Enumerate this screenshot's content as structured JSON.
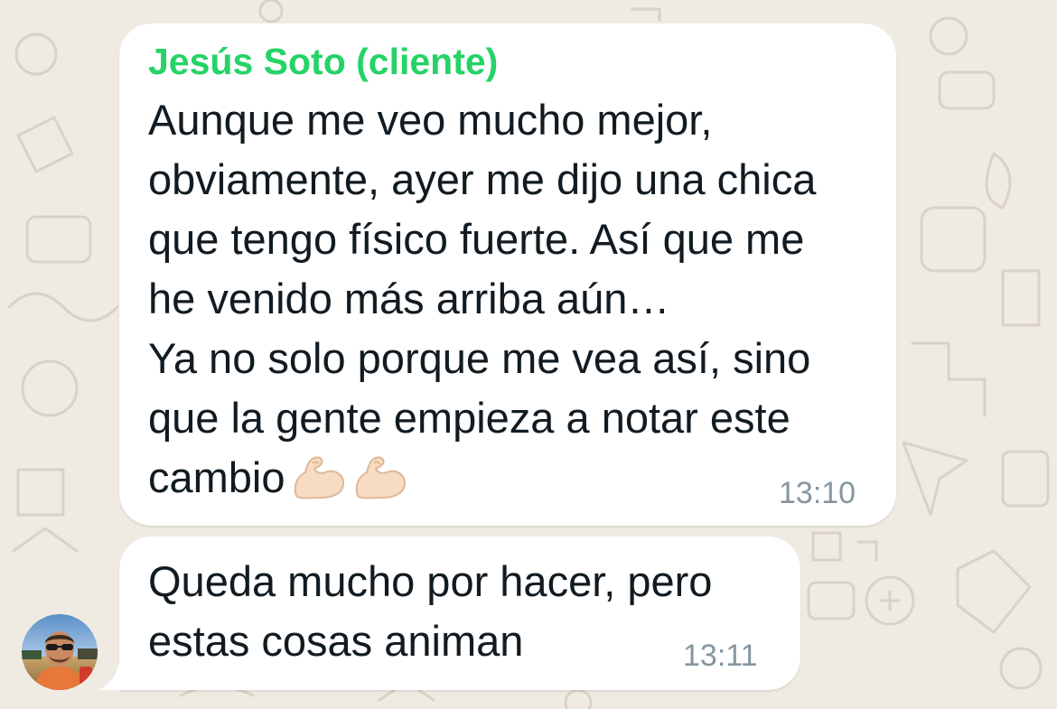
{
  "chat": {
    "wallpaper_color": "#efeae2",
    "messages": [
      {
        "sender": "Jesús Soto (cliente)",
        "sender_color": "#25d366",
        "lines": [
          "Aunque me veo mucho mejor,",
          "obviamente, ayer me dijo una chica",
          "que tengo físico fuerte. Así que me",
          "he venido más arriba aún…",
          "Ya no solo porque me vea así, sino",
          "que la gente empieza a notar este",
          "cambio"
        ],
        "emojis": [
          "flexed-biceps-emoji",
          "flexed-biceps-emoji"
        ],
        "time": "13:10"
      },
      {
        "lines": [
          "Queda mucho por hacer, pero",
          "estas cosas animan"
        ],
        "time": "13:11",
        "avatar": "avatar-photo-man-sunglasses"
      }
    ]
  }
}
